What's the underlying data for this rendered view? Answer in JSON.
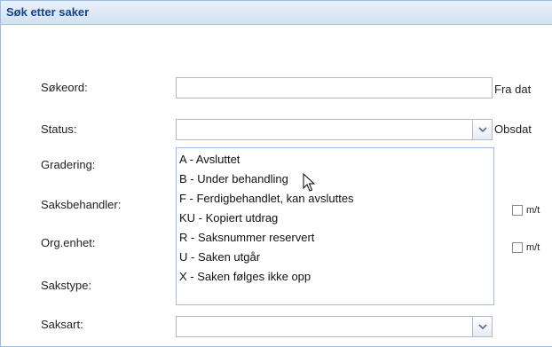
{
  "panel": {
    "title": "Søk etter saker"
  },
  "form": {
    "search_label": "Søkeord:",
    "status_label": "Status:",
    "grading_label": "Gradering:",
    "handler_label": "Saksbehandler:",
    "org_label": "Org.enhet:",
    "casetype_label": "Sakstype:",
    "casekind_label": "Saksart:",
    "from_date_label": "Fra dat",
    "obs_date_label": "Obsdat",
    "checkbox1_label": "m/t",
    "checkbox2_label": "m/t",
    "search_value": "",
    "status_value": "",
    "casekind_value": ""
  },
  "status_options": [
    "A - Avsluttet",
    "B - Under behandling",
    "F - Ferdigbehandlet, kan avsluttes",
    "KU - Kopiert utdrag",
    "R - Saksnummer reservert",
    "U - Saken utgår",
    "X - Saken følges ikke opp"
  ]
}
